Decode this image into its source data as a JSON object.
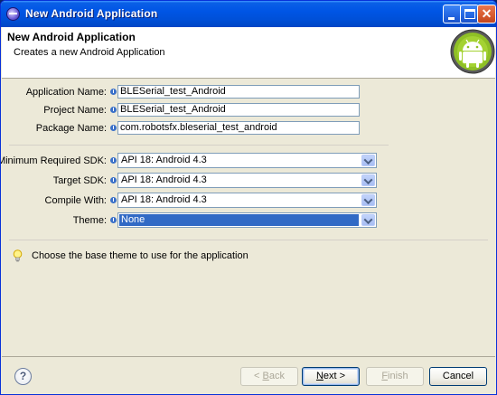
{
  "window": {
    "title": "New Android Application",
    "minimize_label": "_",
    "maximize_label": "□",
    "close_label": "✕"
  },
  "header": {
    "heading": "New Android Application",
    "subtitle": "Creates a new Android Application",
    "logo_icon": "android-robot-icon"
  },
  "form": {
    "application_name": {
      "label": "Application Name:",
      "value": "BLESerial_test_Android"
    },
    "project_name": {
      "label": "Project Name:",
      "value": "BLESerial_test_Android"
    },
    "package_name": {
      "label": "Package Name:",
      "value": "com.robotsfx.bleserial_test_android"
    },
    "min_sdk": {
      "label": "Minimum Required SDK:",
      "value": "API 18: Android 4.3"
    },
    "target_sdk": {
      "label": "Target SDK:",
      "value": "API 18: Android 4.3"
    },
    "compile_with": {
      "label": "Compile With:",
      "value": "API 18: Android 4.3"
    },
    "theme": {
      "label": "Theme:",
      "value": "None"
    }
  },
  "hint": {
    "icon": "lightbulb-icon",
    "text": "Choose the base theme to use for the application"
  },
  "footer": {
    "help_label": "?",
    "back_prefix": "< ",
    "back_mnemonic": "B",
    "back_rest": "ack",
    "next_mnemonic": "N",
    "next_rest": "ext >",
    "finish_mnemonic": "F",
    "finish_rest": "inish",
    "cancel_label": "Cancel"
  },
  "colors": {
    "titlebar": "#0055e5",
    "selection": "#316ac5",
    "dialog_bg": "#ece9d8",
    "info_dot": "#3a70c9"
  }
}
